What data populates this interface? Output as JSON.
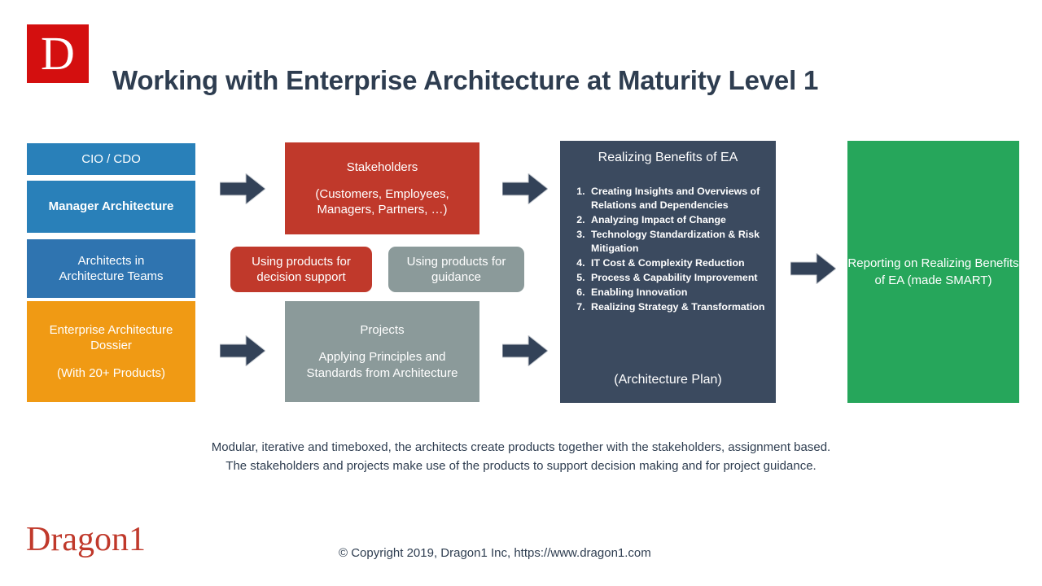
{
  "logo": {
    "letter": "D",
    "brand_color": "#d40f0f"
  },
  "header": {
    "title": "Working with Enterprise Architecture at Maturity Level 1"
  },
  "palette": {
    "blue": "#2980b9",
    "orange": "#f09a14",
    "red": "#c0392b",
    "gray": "#8b9a9a",
    "navy": "#3b4a5f",
    "green": "#26a65b",
    "text_dark": "#2e3d50"
  },
  "left_column": {
    "boxes": [
      {
        "name": "cio-cdo",
        "lines": [
          "CIO / CDO"
        ],
        "color": "#2980b9"
      },
      {
        "name": "manager-architecture",
        "lines": [
          "Manager Architecture"
        ],
        "color": "#2980b9"
      },
      {
        "name": "architects",
        "lines": [
          "Architects in",
          "Architecture Teams"
        ],
        "color": "#2f74b0"
      },
      {
        "name": "ea-dossier",
        "lines": [
          "Enterprise Architecture",
          "Dossier",
          "(With 20+ Products)"
        ],
        "color": "#f09a14"
      }
    ]
  },
  "stakeholders_box": {
    "title": "Stakeholders",
    "detail_line_1": "(Customers, Employees,",
    "detail_line_2": "Managers, Partners, …)",
    "color": "#c0392b"
  },
  "projects_box": {
    "title": "Projects",
    "detail_line_1": "Applying Principles and",
    "detail_line_2": "Standards from Architecture",
    "color": "#8b9a9a"
  },
  "pills": {
    "decision": {
      "line_1": "Using products for",
      "line_2": "decision support",
      "color": "#c0392b"
    },
    "guidance": {
      "line_1": "Using products for",
      "line_2": "guidance",
      "color": "#8b9a9a"
    }
  },
  "realizing_box": {
    "heading_line_1": "Realizing",
    "heading_line_2": "Benefits of EA",
    "items": [
      "Creating Insights and Overviews of Relations and Dependencies",
      "Analyzing Impact of Change",
      "Technology Standardization & Risk Mitigation",
      "IT Cost & Complexity Reduction",
      "Process & Capability Improvement",
      "Enabling Innovation",
      "Realizing Strategy & Transformation"
    ],
    "footer": "(Architecture Plan)",
    "color": "#3b4a5f"
  },
  "reporting_box": {
    "line_1": "Reporting on Realizing",
    "line_2": "Benefits of EA",
    "line_3": "(made SMART)",
    "color": "#26a65b"
  },
  "arrows": [
    {
      "name": "arrow-cio-to-stakeholders"
    },
    {
      "name": "arrow-stakeholders-to-realizing"
    },
    {
      "name": "arrow-dossier-to-projects"
    },
    {
      "name": "arrow-projects-to-realizing"
    },
    {
      "name": "arrow-realizing-to-reporting"
    }
  ],
  "caption": {
    "line_1": "Modular, iterative and timeboxed, the architects create products together with the stakeholders, assignment based.",
    "line_2": "The stakeholders and projects make use of the products to support decision making and for project guidance."
  },
  "footer": {
    "wordmark": "Dragon1",
    "copyright": "© Copyright 2019, Dragon1 Inc, https://www.dragon1.com"
  }
}
